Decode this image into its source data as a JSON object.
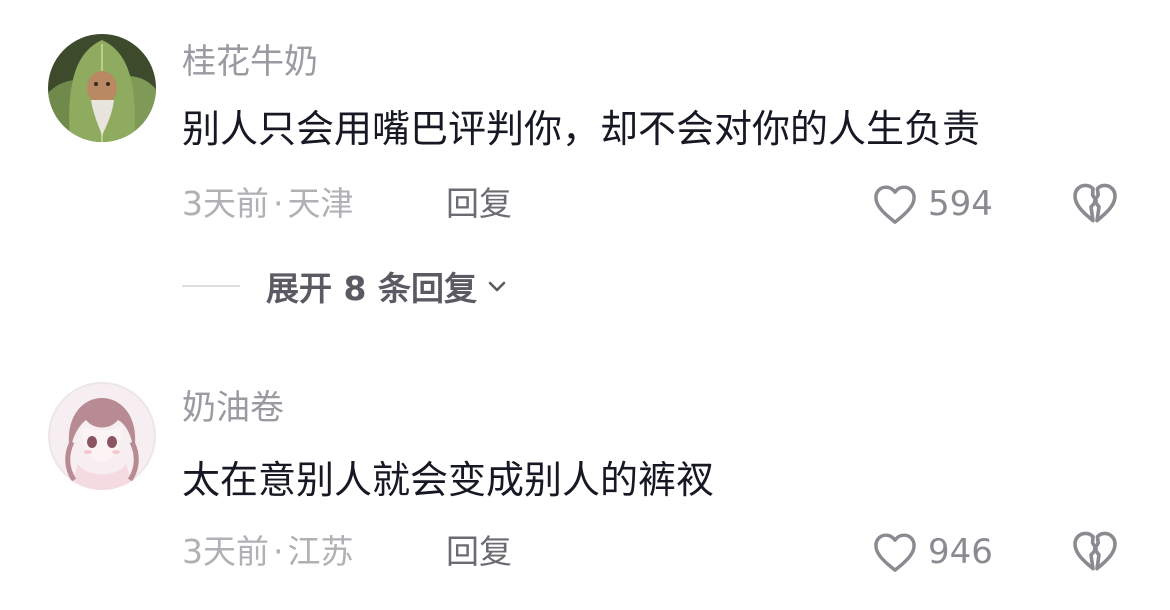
{
  "comments": [
    {
      "username": "桂花牛奶",
      "text": "别人只会用嘴巴评判你，却不会对你的人生负责",
      "time": "3天前",
      "separator": "·",
      "location": "天津",
      "reply_label": "回复",
      "likes": "594",
      "expand_label": "展开 8 条回复"
    },
    {
      "username": "奶油卷",
      "text": "太在意别人就会变成别人的裤衩",
      "time": "3天前",
      "separator": "·",
      "location": "江苏",
      "reply_label": "回复",
      "likes": "946"
    }
  ],
  "icons": {
    "like": "heart-outline-icon",
    "dislike": "broken-heart-icon",
    "expand": "chevron-down-icon"
  },
  "colors": {
    "username": "#9a9aa0",
    "text": "#161823",
    "meta": "#b0b0b5",
    "icon": "#8a8a90"
  }
}
